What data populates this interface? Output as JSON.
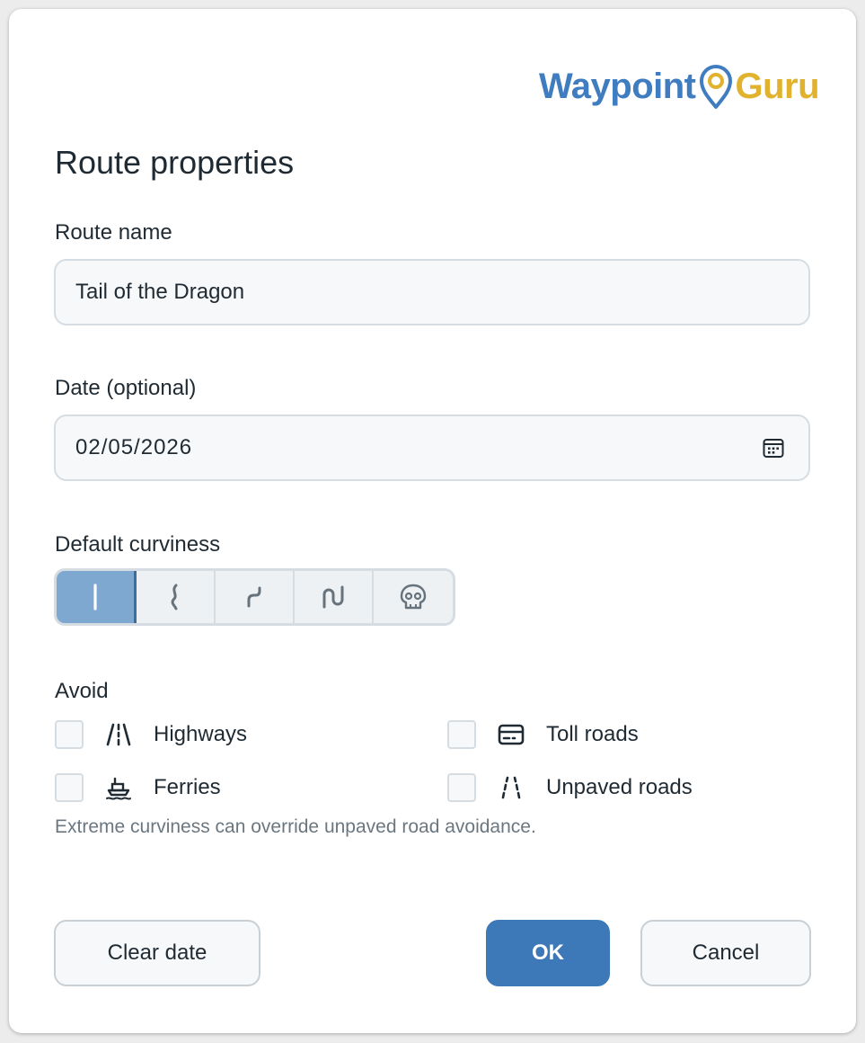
{
  "logo": {
    "part1": "Waypoint",
    "part2": "Guru",
    "icon": "map-pin-icon"
  },
  "dialog": {
    "title": "Route properties"
  },
  "route_name": {
    "label": "Route name",
    "value": "Tail of the Dragon"
  },
  "date": {
    "label": "Date (optional)",
    "value": "02/05/2026",
    "icon": "calendar-icon"
  },
  "curviness": {
    "label": "Default curviness",
    "selected_index": 0,
    "options": [
      {
        "icon": "straight-line-icon"
      },
      {
        "icon": "slight-curve-icon"
      },
      {
        "icon": "curve-icon"
      },
      {
        "icon": "twisty-icon"
      },
      {
        "icon": "skull-icon"
      }
    ]
  },
  "avoid": {
    "label": "Avoid",
    "options": [
      {
        "label": "Highways",
        "icon": "highway-icon",
        "checked": false
      },
      {
        "label": "Toll roads",
        "icon": "toll-card-icon",
        "checked": false
      },
      {
        "label": "Ferries",
        "icon": "ferry-icon",
        "checked": false
      },
      {
        "label": "Unpaved roads",
        "icon": "unpaved-road-icon",
        "checked": false
      }
    ],
    "hint": "Extreme curviness can override unpaved road avoidance."
  },
  "buttons": {
    "clear_date": "Clear date",
    "ok": "OK",
    "cancel": "Cancel"
  },
  "colors": {
    "brand_blue": "#3f7cc0",
    "brand_gold": "#e0b22e",
    "primary_button": "#3d78b8",
    "selected_segment": "#7fa8d1"
  }
}
